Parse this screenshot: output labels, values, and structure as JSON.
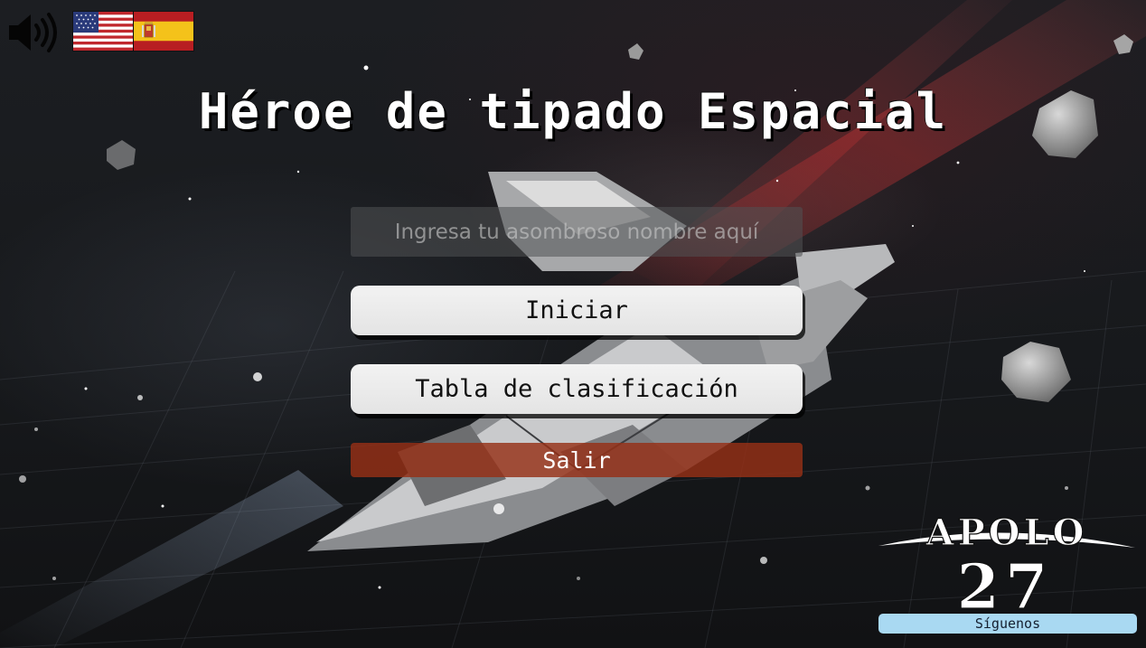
{
  "title": "Héroe de tipado Espacial",
  "name_input": {
    "placeholder": "Ingresa tu asombroso nombre aquí",
    "value": ""
  },
  "buttons": {
    "start": "Iniciar",
    "leaderboard": "Tabla de clasificación",
    "exit": "Salir",
    "follow": "Síguenos"
  },
  "logo": {
    "name": "APOLO",
    "number": "27"
  },
  "icons": {
    "sound": "speaker-on-icon",
    "english": "us-flag-icon",
    "spanish": "spain-flag-icon"
  },
  "colors": {
    "exit_button": "#96301a",
    "follow_button": "#a9d9f2",
    "primary_button": "#eeeeee",
    "title_text": "#ffffff"
  }
}
